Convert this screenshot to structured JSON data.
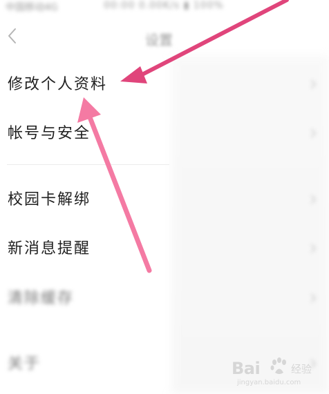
{
  "status_bar": {
    "carrier": "中国移动4G",
    "right_info": "00:00 0.00K/s ▮ 100%"
  },
  "nav": {
    "title": "设置"
  },
  "items": [
    {
      "label": "修改个人资料"
    },
    {
      "label": "帐号与安全"
    },
    {
      "label": "校园卡解绑"
    },
    {
      "label": "新消息提醒"
    },
    {
      "label": "清除缓存"
    },
    {
      "label": "关于"
    }
  ],
  "annotation": {
    "arrow_color_top": "#e0457b",
    "arrow_color_bottom": "#f47aa3"
  },
  "watermark": {
    "brand": "Bai",
    "jingyan": "经验",
    "url": "jingyan.baidu.com"
  }
}
